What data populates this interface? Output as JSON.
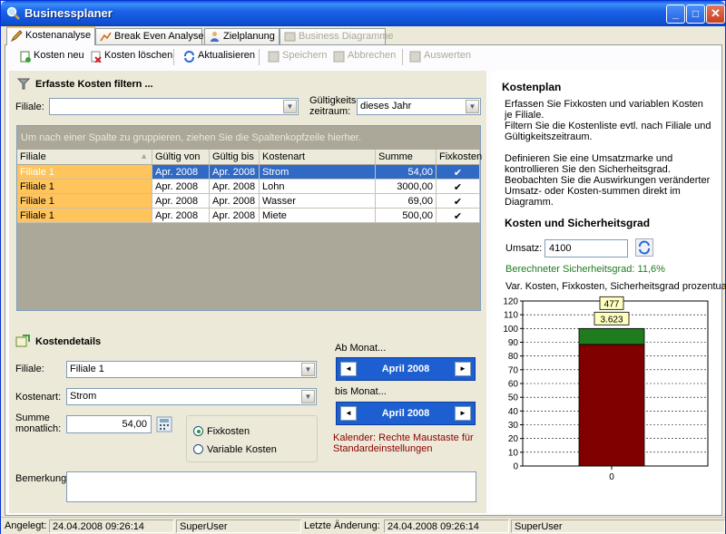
{
  "window": {
    "title": "Businessplaner",
    "min": "_",
    "max": "□",
    "close": "✕"
  },
  "tabs": [
    {
      "label": "Kostenanalyse",
      "active": true,
      "disabled": false
    },
    {
      "label": "Break Even Analyse",
      "active": false,
      "disabled": false
    },
    {
      "label": "Zielplanung",
      "active": false,
      "disabled": false
    },
    {
      "label": "Business Diagramme",
      "active": false,
      "disabled": true
    }
  ],
  "toolbar": {
    "new": "Kosten neu",
    "delete": "Kosten löschen",
    "refresh": "Aktualisieren",
    "save": "Speichern",
    "cancel": "Abbrechen",
    "evaluate": "Auswerten"
  },
  "filter": {
    "heading": "Erfasste Kosten filtern ...",
    "filiale_label": "Filiale:",
    "filiale_value": "",
    "period_label_1": "Gültigkeits-",
    "period_label_2": "zeitraum:",
    "period_value": "dieses Jahr"
  },
  "grid": {
    "group_hint": "Um nach einer Spalte zu gruppieren, ziehen Sie die Spaltenkopfzeile hierher.",
    "columns": [
      "Filiale",
      "Gültig von",
      "Gültig bis",
      "Kostenart",
      "Summe",
      "Fixkosten"
    ],
    "sort_indicator": "▲",
    "rows": [
      {
        "filiale": "Filiale 1",
        "von": "Apr. 2008",
        "bis": "Apr. 2008",
        "kostenart": "Strom",
        "summe": "54,00",
        "fix": "✔"
      },
      {
        "filiale": "Filiale 1",
        "von": "Apr. 2008",
        "bis": "Apr. 2008",
        "kostenart": "Lohn",
        "summe": "3000,00",
        "fix": "✔"
      },
      {
        "filiale": "Filiale 1",
        "von": "Apr. 2008",
        "bis": "Apr. 2008",
        "kostenart": "Wasser",
        "summe": "69,00",
        "fix": "✔"
      },
      {
        "filiale": "Filiale 1",
        "von": "Apr. 2008",
        "bis": "Apr. 2008",
        "kostenart": "Miete",
        "summe": "500,00",
        "fix": "✔"
      }
    ]
  },
  "details": {
    "heading": "Kostendetails",
    "filiale_label": "Filiale:",
    "filiale_value": "Filiale 1",
    "kostenart_label": "Kostenart:",
    "kostenart_value": "Strom",
    "summe_label_1": "Summe",
    "summe_label_2": "monatlich:",
    "summe_value": "54,00",
    "fix_label": "Fixkosten",
    "var_label": "Variable Kosten",
    "bemerkung_label": "Bemerkung:",
    "bemerkung_value": "",
    "ab_label": "Ab Monat...",
    "ab_value": "April 2008",
    "bis_label": "bis Monat...",
    "bis_value": "April 2008",
    "prev": "◄",
    "next": "►",
    "calendar_note_1": "Kalender: Rechte Maustaste für",
    "calendar_note_2": "Standardeinstellungen"
  },
  "info": {
    "heading": "Kostenplan",
    "text1": "Erfassen Sie Fixkosten und variablen Kosten je Filiale.",
    "text2": "Filtern Sie die Kostenliste evtl. nach Filiale und Gültigkeitszeitraum.",
    "text3": "Definieren Sie eine Umsatzmarke und kontrollieren Sie den Sicherheitsgrad. Beobachten Sie die Auswirkungen veränderter Umsatz- oder Kosten-summen direkt im Diagramm.",
    "chart_heading": "Kosten und Sicherheitsgrad",
    "umsatz_label": "Umsatz:",
    "umsatz_value": "4100",
    "result": "Berechneter Sicherheitsgrad: 11,6%",
    "chart_caption": "Var. Kosten, Fixkosten, Sicherheitsgrad prozentual",
    "colors": {
      "fix": "#800000",
      "var": "#1e7b1e",
      "result_text": "#1e7b1e"
    }
  },
  "chart_data": {
    "type": "bar",
    "categories": [
      "0"
    ],
    "ylim": [
      0,
      120
    ],
    "yticks": [
      0,
      10,
      20,
      30,
      40,
      50,
      60,
      70,
      80,
      90,
      100,
      110,
      120
    ],
    "series": [
      {
        "values": [
          88.4
        ],
        "color": "#800000"
      },
      {
        "values": [
          11.6
        ],
        "color": "#1e7b1e"
      }
    ],
    "data_labels": [
      "3.623",
      "477"
    ]
  },
  "status": {
    "created_label": "Angelegt:",
    "created_value": "24.04.2008 09:26:14",
    "created_user": "SuperUser",
    "changed_label": "Letzte Änderung:",
    "changed_value": "24.04.2008 09:26:14",
    "changed_user": "SuperUser"
  }
}
